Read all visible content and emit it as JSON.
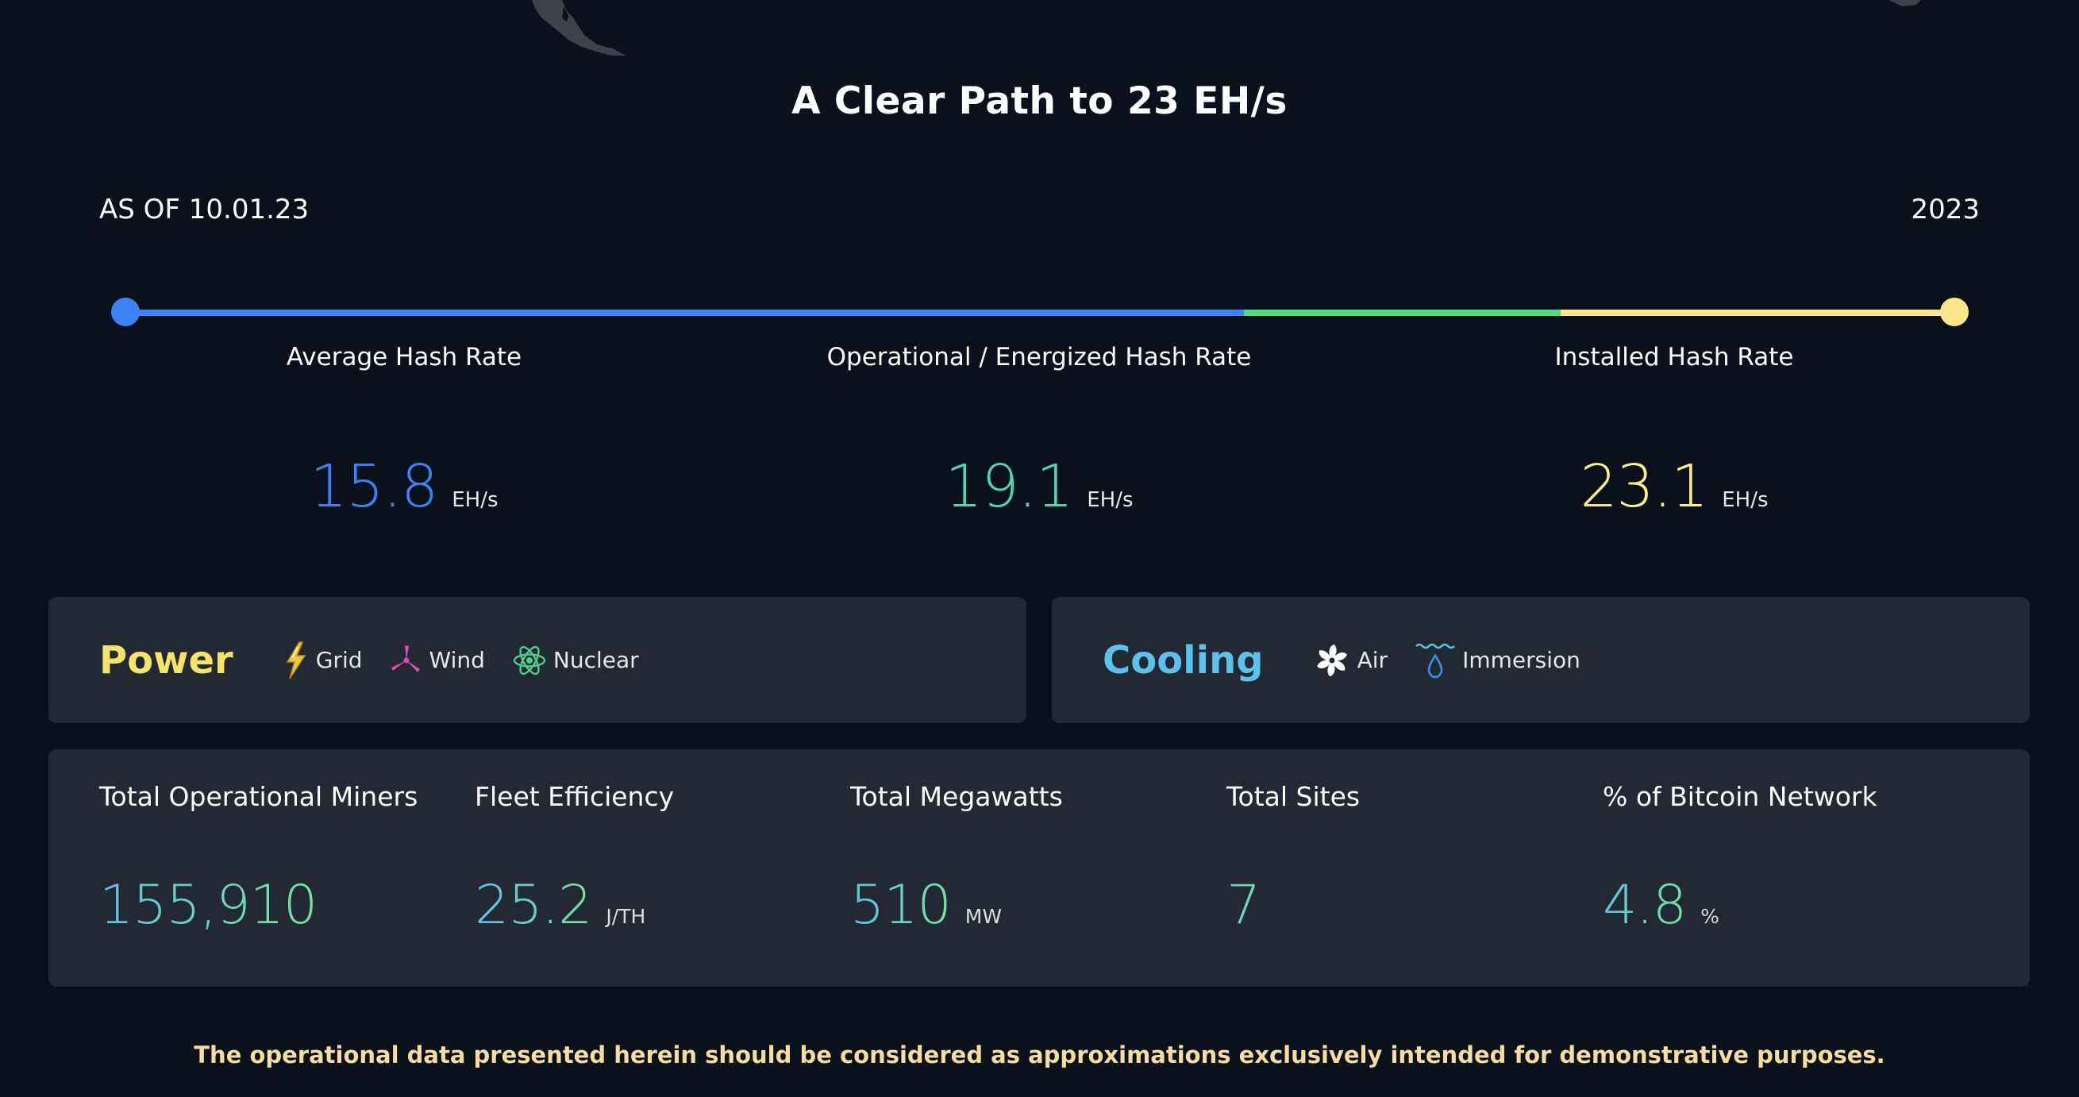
{
  "header": {
    "title": "A Clear Path to 23 EH/s",
    "as_of": "AS OF 10.01.23",
    "year": "2023"
  },
  "timeline": {
    "colors": [
      "#3b82f6",
      "#4ade80",
      "#fde68a"
    ]
  },
  "hash_rates": [
    {
      "label": "Average Hash Rate",
      "value": "15.8",
      "unit": "EH/s",
      "color": "#3b82f6"
    },
    {
      "label": "Operational / Energized Hash Rate",
      "value": "19.1",
      "unit": "EH/s",
      "color": "#4ad7b3"
    },
    {
      "label": "Installed Hash Rate",
      "value": "23.1",
      "unit": "EH/s",
      "color": "#fbef8a"
    }
  ],
  "power": {
    "title": "Power",
    "title_color": "#f4e56a",
    "sources": [
      {
        "label": "Grid",
        "icon": "lightning-icon"
      },
      {
        "label": "Wind",
        "icon": "wind-turbine-icon"
      },
      {
        "label": "Nuclear",
        "icon": "atom-icon"
      }
    ]
  },
  "cooling": {
    "title": "Cooling",
    "title_color": "#5bc2ee",
    "methods": [
      {
        "label": "Air",
        "icon": "fan-icon"
      },
      {
        "label": "Immersion",
        "icon": "water-drop-icon"
      }
    ]
  },
  "stats": [
    {
      "label": "Total Operational Miners",
      "value": "155,910",
      "unit": ""
    },
    {
      "label": "Fleet Efficiency",
      "value": "25.2",
      "unit": "J/TH"
    },
    {
      "label": "Total Megawatts",
      "value": "510",
      "unit": "MW"
    },
    {
      "label": "Total Sites",
      "value": "7",
      "unit": ""
    },
    {
      "label": "% of Bitcoin Network",
      "value": "4.8",
      "unit": "%"
    }
  ],
  "disclaimer": "The operational data presented herein should be considered as approximations exclusively intended for demonstrative purposes."
}
